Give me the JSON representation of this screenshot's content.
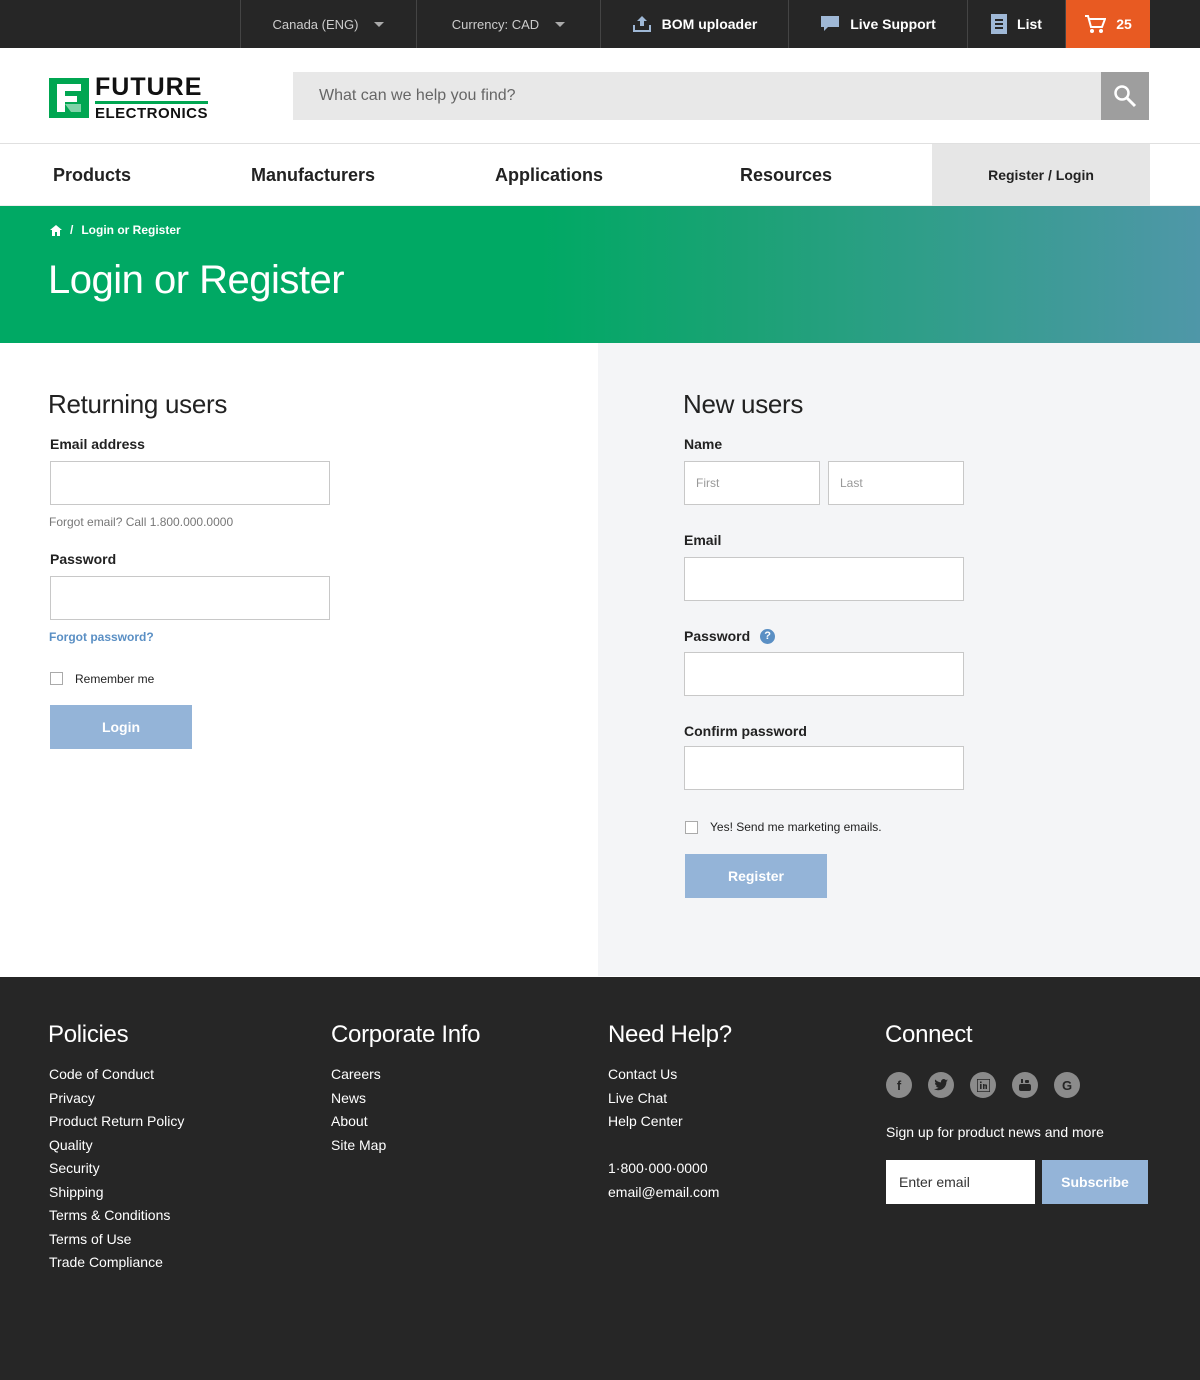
{
  "topbar": {
    "region": "Canada (ENG)",
    "currency": "Currency: CAD",
    "bom": "BOM uploader",
    "support": "Live Support",
    "list": "List",
    "cart_count": "25"
  },
  "header": {
    "logo_line1": "FUTURE",
    "logo_line2": "ELECTRONICS",
    "search_placeholder": "What can we help you find?"
  },
  "nav": {
    "items": [
      "Products",
      "Manufacturers",
      "Applications",
      "Resources"
    ],
    "login": "Register / Login"
  },
  "hero": {
    "breadcrumb_current": "Login or Register",
    "title": "Login or Register"
  },
  "returning": {
    "title": "Returning users",
    "email_label": "Email address",
    "forgot_email": "Forgot email? Call 1.800.000.0000",
    "password_label": "Password",
    "forgot_password": "Forgot password?",
    "remember": "Remember me",
    "login_button": "Login"
  },
  "new_users": {
    "title": "New users",
    "name_label": "Name",
    "first_placeholder": "First",
    "last_placeholder": "Last",
    "email_label": "Email",
    "password_label": "Password",
    "help_glyph": "?",
    "confirm_label": "Confirm password",
    "marketing": "Yes! Send me marketing emails.",
    "register_button": "Register"
  },
  "footer": {
    "policies": {
      "title": "Policies",
      "items": [
        "Code of Conduct",
        "Privacy",
        "Product Return Policy",
        "Quality",
        "Security",
        "Shipping",
        "Terms & Conditions",
        "Terms of Use",
        "Trade Compliance"
      ]
    },
    "corporate": {
      "title": "Corporate Info",
      "items": [
        "Careers",
        "News",
        "About",
        "Site Map"
      ]
    },
    "help": {
      "title": "Need Help?",
      "items": [
        "Contact Us",
        "Live Chat",
        "Help Center"
      ],
      "phone": "1·800·000·0000",
      "email": "email@email.com"
    },
    "connect": {
      "title": "Connect",
      "signup": "Sign up for product news and more",
      "email_placeholder": "Enter email",
      "subscribe": "Subscribe"
    }
  },
  "colors": {
    "accent_orange": "#e85a22",
    "brand_green": "#00a651",
    "button_blue": "#94b4d8",
    "dark": "#262626"
  }
}
